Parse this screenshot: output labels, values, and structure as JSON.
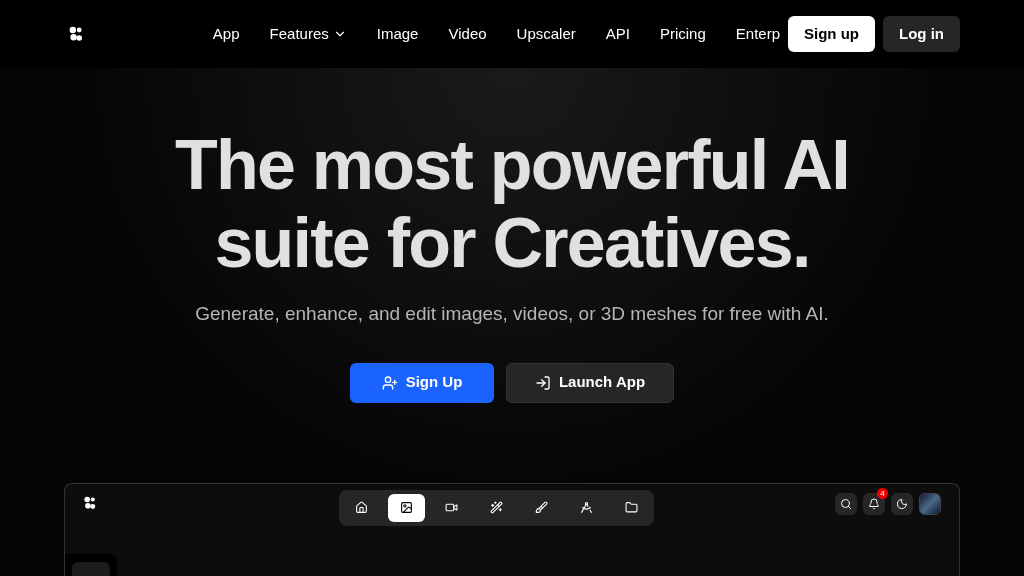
{
  "nav": {
    "links": [
      {
        "label": "App",
        "dropdown": false
      },
      {
        "label": "Features",
        "dropdown": true
      },
      {
        "label": "Image",
        "dropdown": false
      },
      {
        "label": "Video",
        "dropdown": false
      },
      {
        "label": "Upscaler",
        "dropdown": false
      },
      {
        "label": "API",
        "dropdown": false
      },
      {
        "label": "Pricing",
        "dropdown": false
      },
      {
        "label": "Enterp",
        "dropdown": false
      }
    ],
    "signup": "Sign up",
    "login": "Log in"
  },
  "hero": {
    "title_lines": [
      "The most powerful AI",
      "suite for Creatives."
    ],
    "subtitle": "Generate, enhance, and edit images, videos, or 3D meshes for free with AI.",
    "primary": "Sign Up",
    "secondary": "Launch App"
  },
  "preview": {
    "tools": [
      {
        "kind": "home",
        "selected": false
      },
      {
        "kind": "image",
        "selected": true
      },
      {
        "kind": "video",
        "selected": false
      },
      {
        "kind": "wand",
        "selected": false
      },
      {
        "kind": "brush",
        "selected": false
      },
      {
        "kind": "compass",
        "selected": false
      },
      {
        "kind": "folder",
        "selected": false
      }
    ],
    "notifications": "4"
  }
}
